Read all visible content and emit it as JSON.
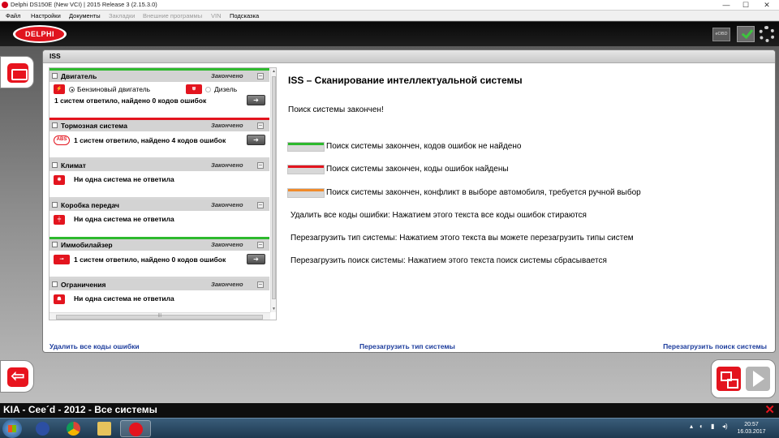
{
  "window": {
    "title": "Delphi DS150E (New VCI) | 2015 Release 3 (2.15.3.0)",
    "minimize": "—",
    "maximize": "☐",
    "close": "✕"
  },
  "menu": {
    "items": [
      "Файл",
      "Настройки",
      "Документы",
      "Закладки",
      "Внешние программы",
      "VIN",
      "Подсказка"
    ],
    "disabled": [
      "Закладки",
      "Внешние программы",
      "VIN"
    ]
  },
  "header": {
    "logo_text": "DELPHI",
    "eobd_label": "eOBD"
  },
  "tab": {
    "label": "ISS"
  },
  "systems": [
    {
      "name": "Двигатель",
      "status": "Закончено",
      "stripe_color": "#2db92d",
      "icon": "engine-icon",
      "engine_options": {
        "petrol": "Бензиновый двигатель",
        "diesel": "Дизель"
      },
      "result": "1 систем ответило, найдено 0 кодов ошибок",
      "has_arrow": true
    },
    {
      "name": "Тормозная система",
      "status": "Закончено",
      "stripe_color": "#e3141e",
      "icon": "abs-icon",
      "icon_text": "ABS",
      "result": "1 систем ответило, найдено 4 кодов ошибок",
      "has_arrow": true
    },
    {
      "name": "Климат",
      "status": "Закончено",
      "stripe_color": "#d6d6d6",
      "icon": "climate-icon",
      "result": "Ни одна система не ответила",
      "has_arrow": false
    },
    {
      "name": "Коробка передач",
      "status": "Закончено",
      "stripe_color": "#d6d6d6",
      "icon": "gearbox-icon",
      "result": "Ни одна система не ответила",
      "has_arrow": false
    },
    {
      "name": "Иммобилайзер",
      "status": "Закончено",
      "stripe_color": "#2db92d",
      "icon": "immobilizer-key-icon",
      "result": "1 систем ответило, найдено 0 кодов ошибок",
      "has_arrow": true
    },
    {
      "name": "Ограничения",
      "status": "Закончено",
      "stripe_color": "#d6d6d6",
      "icon": "restraint-airbag-icon",
      "result": "Ни одна система не ответила",
      "has_arrow": false
    }
  ],
  "details": {
    "title": "ISS – Сканирование интеллектуальной системы",
    "status": "Поиск системы закончен!",
    "legend": [
      {
        "color": "#2db92d",
        "text": "Поиск системы закончен, кодов ошибок не найдено"
      },
      {
        "color": "#e3141e",
        "text": "Поиск системы закончен, коды ошибок найдены"
      },
      {
        "color": "#f08a2a",
        "text": "Поиск системы закончен, конфликт в выборе автомобиля, требуется ручной выбор"
      }
    ],
    "help": [
      "Удалить все коды ошибки: Нажатием этого текста все коды ошибок стираются",
      "Перезагрузить тип системы: Нажатием этого текста вы можете перезагрузить типы систем",
      "Перезагрузить поиск системы: Нажатием этого текста поиск системы сбрасывается"
    ]
  },
  "links": {
    "clear_codes": "Удалить все коды ошибки",
    "reload_type": "Перезагрузить тип системы",
    "reload_search": "Перезагрузить поиск системы"
  },
  "vehicle": {
    "label": "KIA - Cee´d - 2012 - Все системы"
  },
  "taskbar": {
    "time": "20:57",
    "date": "16.03.2017"
  },
  "colors": {
    "brand_red": "#e3141e",
    "ok_green": "#2db92d",
    "conflict_orange": "#f08a2a",
    "link_blue": "#1c3c9c"
  }
}
